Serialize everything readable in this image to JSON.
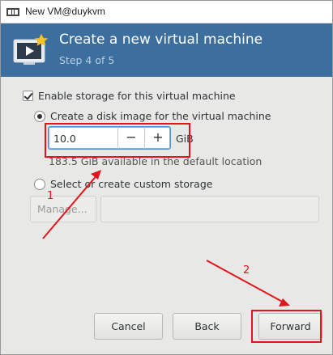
{
  "window": {
    "title": "New VM@duykvm"
  },
  "header": {
    "heading": "Create a new virtual machine",
    "step": "Step 4 of 5"
  },
  "storage": {
    "enable_label": "Enable storage for this virtual machine",
    "enable_checked": true,
    "create_disk_label": "Create a disk image for the virtual machine",
    "create_disk_selected": true,
    "size_value": "10.0",
    "size_unit": "GiB",
    "minus_symbol": "−",
    "plus_symbol": "+",
    "available_text": "183.5 GiB available in the default location",
    "custom_label": "Select or create custom storage",
    "custom_selected": false,
    "manage_label": "Manage...",
    "custom_path_value": ""
  },
  "buttons": {
    "cancel": "Cancel",
    "back": "Back",
    "forward": "Forward"
  },
  "annotations": {
    "marker_1": "1",
    "marker_2": "2",
    "color": "#e3141a"
  }
}
